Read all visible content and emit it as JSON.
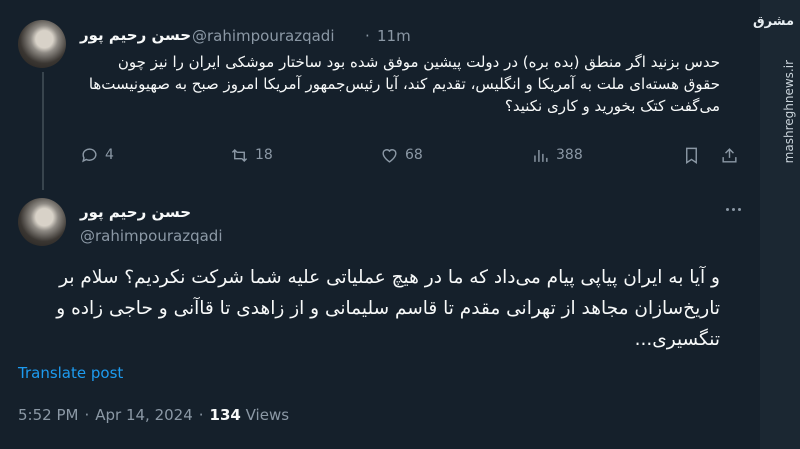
{
  "tweet1": {
    "name": "حسن رحیم پور",
    "handle": "@rahimpourazqadi",
    "separator": "·",
    "time": "11m",
    "text": "حدس بزنید اگر منطق (بده بره) در دولت پیشین موفق شده بود ساختار موشکی ایران را نیز چون حقوق هسته‌ای ملت به آمریکا و انگلیس، تقدیم کند، آیا رئیس‌جمهور آمریکا امروز صبح به صهیونیست‌ها می‌گفت کتک بخورید و کاری نکنید؟",
    "replies": "4",
    "reposts": "18",
    "likes": "68",
    "views": "388"
  },
  "tweet2": {
    "name": "حسن رحیم پور",
    "handle": "@rahimpourazqadi",
    "text": "و آیا به ایران پیاپی پیام می‌داد که ما در هیچ عملیاتی علیه شما شرکت نکردیم؟ سلام بر تاریخ‌سازان مجاهد از تهرانی مقدم تا قاسم سلیمانی و از زاهدی تا قاآنی و حاجی زاده و تنگسیری...",
    "translate_label": "Translate post",
    "time": "5:52 PM",
    "date": "Apr 14, 2024",
    "views_count": "134",
    "views_label": "Views"
  },
  "watermark": {
    "logo": "مشرق",
    "site": "mashreghnews.ir"
  },
  "icons": [
    "reply-icon",
    "repost-icon",
    "like-icon",
    "views-icon",
    "bookmark-icon",
    "share-icon",
    "more-icon"
  ],
  "colors": {
    "background": "#15202b",
    "accent": "#1d9bf0",
    "muted": "#8b98a5",
    "text": "#f7f9f9"
  }
}
